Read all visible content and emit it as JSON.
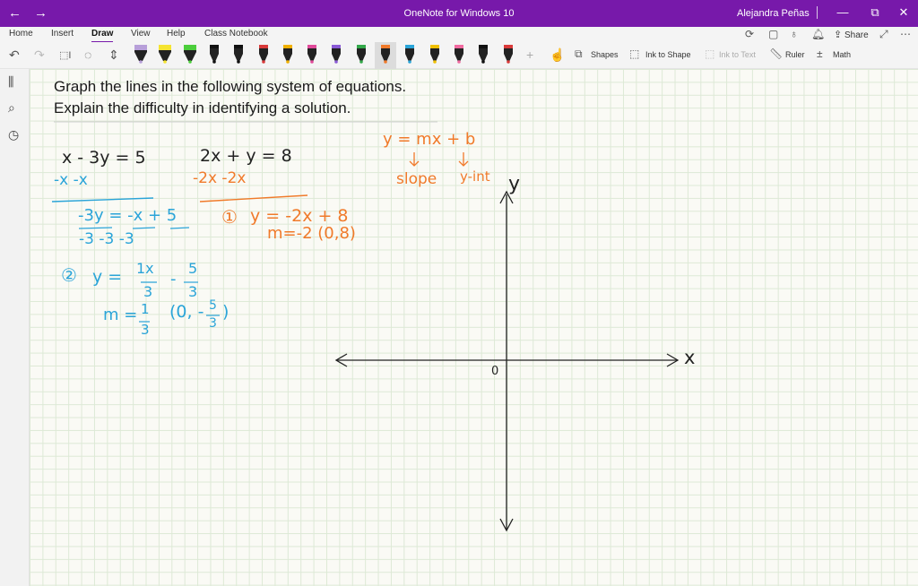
{
  "window": {
    "title": "OneNote for Windows 10",
    "user": "Alejandra Peñas",
    "back_icon": "←",
    "forward_icon": "→",
    "minimize_icon": "—",
    "restore_icon": "⧉",
    "close_icon": "✕"
  },
  "menu": {
    "tabs": [
      "Home",
      "Insert",
      "Draw",
      "View",
      "Help",
      "Class Notebook"
    ],
    "active_tab": "Draw",
    "share_label": "Share"
  },
  "toolbar": {
    "shapes_label": "Shapes",
    "ink_to_shape_label": "Ink to Shape",
    "ink_to_text_label": "Ink to Text",
    "ruler_label": "Ruler",
    "math_label": "Math",
    "pens": [
      {
        "color": "#b79fd9",
        "kind": "highlighter"
      },
      {
        "color": "#f5e431",
        "kind": "highlighter"
      },
      {
        "color": "#4cce3c",
        "kind": "highlighter"
      },
      {
        "color": "#111111",
        "kind": "pen"
      },
      {
        "color": "#111111",
        "kind": "pen"
      },
      {
        "color": "#d93a3a",
        "kind": "pen"
      },
      {
        "color": "#f0b000",
        "kind": "pen"
      },
      {
        "color": "#e04a9a",
        "kind": "pen"
      },
      {
        "color": "#8a5ad6",
        "kind": "pen"
      },
      {
        "color": "#33a84a",
        "kind": "pen"
      },
      {
        "color": "#f07a2a",
        "kind": "pen",
        "selected": true
      },
      {
        "color": "#2aa4d8",
        "kind": "pen"
      },
      {
        "color": "#f0c000",
        "kind": "pen"
      },
      {
        "color": "#f06aa0",
        "kind": "pen"
      },
      {
        "color": "#111111",
        "kind": "pen"
      },
      {
        "color": "#d93a3a",
        "kind": "pen"
      }
    ]
  },
  "page": {
    "line1": "Graph the lines in the following system of equations.",
    "line2": "Explain the difficulty in identifying a solution."
  },
  "ink": {
    "eq1": "x - 3y = 5",
    "eq1_sub": "-x      -x",
    "eq1_div_num": "-3y = -x + 5",
    "eq1_div_den": "-3      -3      -3",
    "step2_marker": "②",
    "eq1_result": "y = 1x/3 - 5/3",
    "eq1_result_left": "y =",
    "eq1_frac1_num": "1x",
    "eq1_frac1_den": "3",
    "eq1_frac2_num": "5",
    "eq1_frac2_den": "3",
    "eq1_slope_m": "m =",
    "eq1_slope_num": "1",
    "eq1_slope_den": "3",
    "eq1_intercept_open": "(0, -",
    "eq1_intercept_num": "5",
    "eq1_intercept_den": "3",
    "eq1_intercept_close": ")",
    "eq2": "2x + y = 8",
    "eq2_sub": "-2x        -2x",
    "step1_marker": "①",
    "eq2_result": "y = -2x + 8",
    "eq2_slope": "m=-2   (0,8)",
    "slope_form": "y = mx + b",
    "slope_label": "slope",
    "yint_label": "y-int",
    "axis_y": "y",
    "axis_x": "x",
    "origin": "0"
  },
  "colors": {
    "accent": "#7719aa",
    "ink_black": "#222222",
    "ink_blue": "#2aa4d8",
    "ink_orange": "#f07a2a",
    "grid": "#dde9d6"
  }
}
